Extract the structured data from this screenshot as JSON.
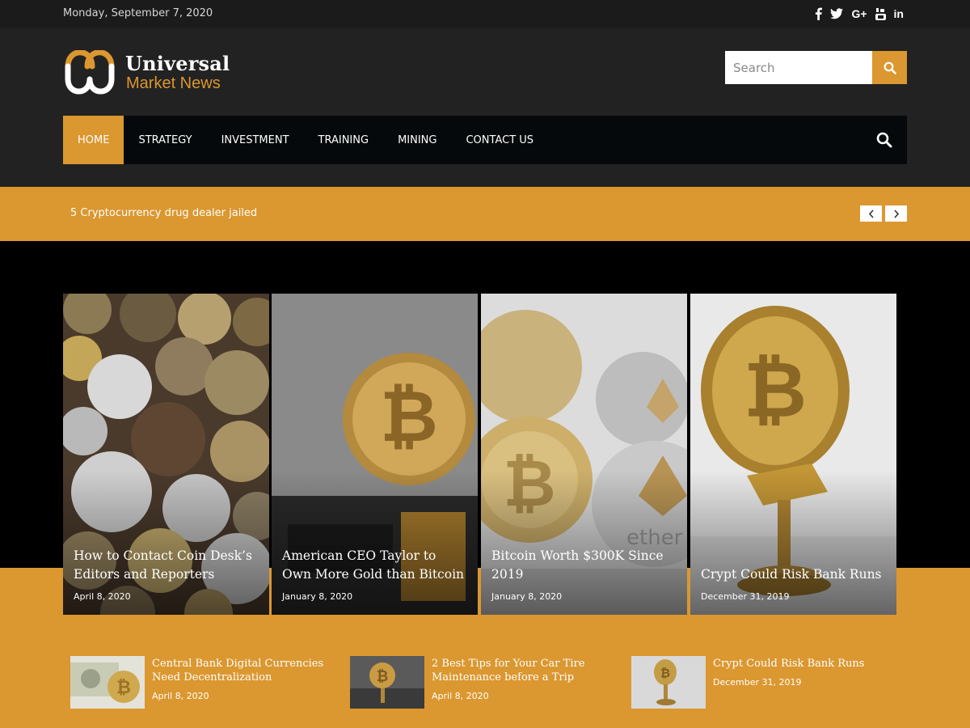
{
  "topbar": {
    "date": "Monday, September 7, 2020",
    "social": [
      {
        "icon": "facebook-icon",
        "glyph": "f"
      },
      {
        "icon": "twitter-icon",
        "glyph": "t"
      },
      {
        "icon": "google-plus-icon",
        "glyph": "G+"
      },
      {
        "icon": "youtube-icon",
        "glyph": "You"
      },
      {
        "icon": "linkedin-icon",
        "glyph": "in"
      }
    ]
  },
  "brand": {
    "title": "Universal",
    "subtitle": "Market News",
    "accent": "#db9730"
  },
  "search": {
    "placeholder": "Search"
  },
  "nav": {
    "items": [
      "HOME",
      "STRATEGY",
      "INVESTMENT",
      "TRAINING",
      "MINING",
      "CONTACT US"
    ],
    "active": "HOME"
  },
  "ticker": {
    "text": "5 Cryptocurrency drug dealer jailed"
  },
  "featured": [
    {
      "title": "How to Contact Coin Desk’s Editors and Reporters",
      "date": "April 8, 2020"
    },
    {
      "title": "American CEO Taylor to Own More Gold than Bitcoin",
      "date": "January 8, 2020"
    },
    {
      "title": "Bitcoin Worth $300K Since 2019",
      "date": "January 8, 2020"
    },
    {
      "title": "Crypt Could Risk Bank Runs",
      "date": "December 31, 2019"
    }
  ],
  "latest": [
    {
      "title": "Central Bank Digital Currencies Need Decentralization",
      "date": "April 8, 2020"
    },
    {
      "title": "2 Best Tips for Your Car Tire Maintenance before a Trip",
      "date": "April 8, 2020"
    },
    {
      "title": "Crypt Could Risk Bank Runs",
      "date": "December 31, 2019"
    }
  ]
}
